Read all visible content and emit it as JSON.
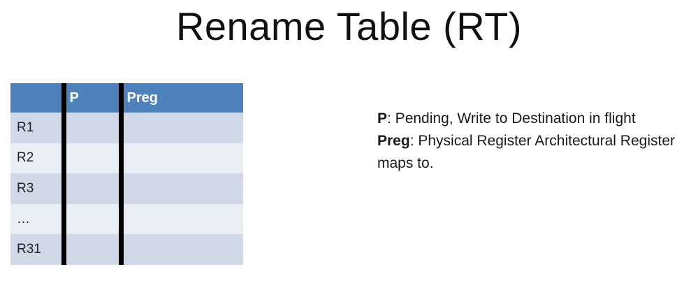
{
  "slide": {
    "title": "Rename Table (RT)"
  },
  "table": {
    "headers": {
      "reg": "",
      "p": "P",
      "preg": "Preg"
    },
    "rows": [
      {
        "reg": "R1",
        "p": "",
        "preg": ""
      },
      {
        "reg": "R2",
        "p": "",
        "preg": ""
      },
      {
        "reg": "R3",
        "p": "",
        "preg": ""
      },
      {
        "reg": "…",
        "p": "",
        "preg": ""
      },
      {
        "reg": "R31",
        "p": "",
        "preg": ""
      }
    ]
  },
  "legend": {
    "p": {
      "term": "P",
      "desc": ": Pending, Write to Destination in flight"
    },
    "preg": {
      "term": "Preg",
      "desc": ": Physical Register Architectural Register maps to."
    }
  },
  "colors": {
    "header_bg": "#4f81bd",
    "row_dark": "#d0d8e8",
    "row_light": "#e9edf4",
    "divider": "#000000"
  }
}
